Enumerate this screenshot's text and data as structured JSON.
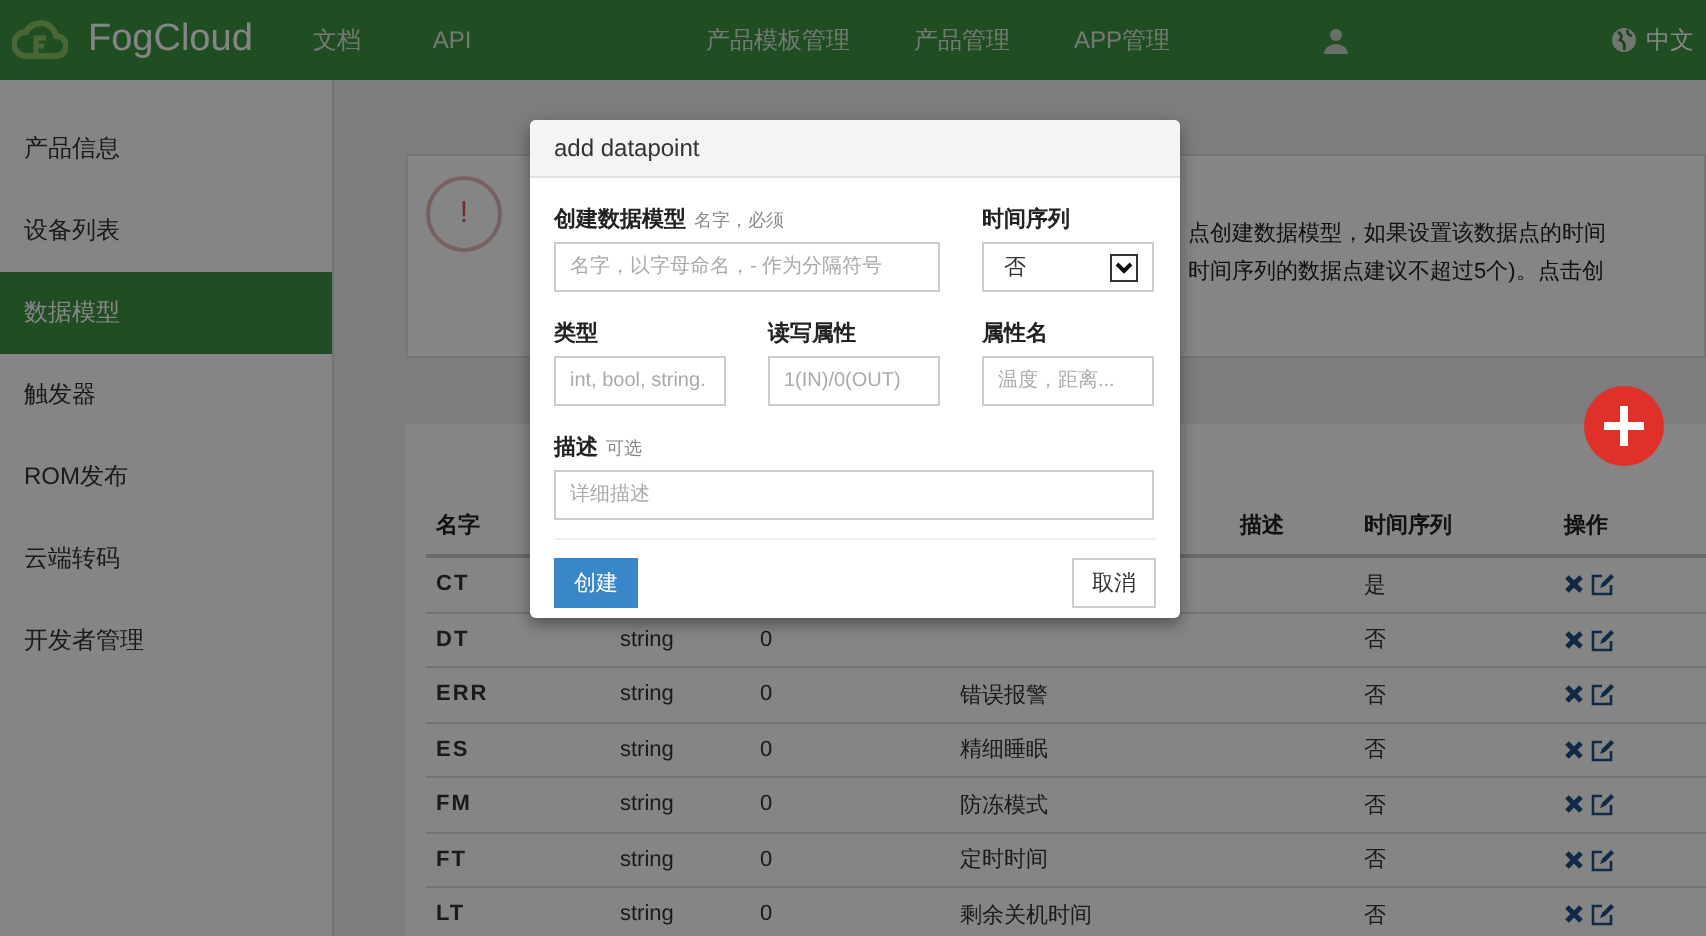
{
  "header": {
    "brand": "FogCloud",
    "nav_left": [
      "文档",
      "API"
    ],
    "nav_right": [
      "产品模板管理",
      "产品管理",
      "APP管理"
    ],
    "language": "中文"
  },
  "sidebar": {
    "items": [
      {
        "label": "产品信息",
        "selected": false
      },
      {
        "label": "设备列表",
        "selected": false
      },
      {
        "label": "数据模型",
        "selected": true
      },
      {
        "label": "触发器",
        "selected": false
      },
      {
        "label": "ROM发布",
        "selected": false
      },
      {
        "label": "云端转码",
        "selected": false
      },
      {
        "label": "开发者管理",
        "selected": false
      }
    ]
  },
  "notice": {
    "icon": "!",
    "lines": [
      "点创建数据模型，如果设置该数据点的时间",
      "时间序列的数据点建议不超过5个)。点击创"
    ]
  },
  "table": {
    "columns": [
      "名字",
      null,
      null,
      null,
      "描述",
      "时间序列",
      "操作"
    ],
    "rows": [
      [
        "CT",
        null,
        null,
        null,
        null,
        "是"
      ],
      [
        "DT",
        "string",
        "0",
        null,
        null,
        "否"
      ],
      [
        "ERR",
        "string",
        "0",
        "错误报警",
        null,
        "否"
      ],
      [
        "ES",
        "string",
        "0",
        "精细睡眠",
        null,
        "否"
      ],
      [
        "FM",
        "string",
        "0",
        "防冻模式",
        null,
        "否"
      ],
      [
        "FT",
        "string",
        "0",
        "定时时间",
        null,
        "否"
      ],
      [
        "LT",
        "string",
        "0",
        "剩余关机时间",
        null,
        "否"
      ]
    ]
  },
  "dialog": {
    "title": "add datapoint",
    "name_field": {
      "label": "创建数据模型",
      "hint": "名字，必须",
      "placeholder": "名字，以字母命名，- 作为分隔符号"
    },
    "series_field": {
      "label": "时间序列",
      "value": "否"
    },
    "type_field": {
      "label": "类型",
      "placeholder": "int, bool, string."
    },
    "rw_field": {
      "label": "读写属性",
      "placeholder": "1(IN)/0(OUT)"
    },
    "attr_field": {
      "label": "属性名",
      "placeholder": "温度，距离..."
    },
    "desc_field": {
      "label": "描述",
      "hint": "可选",
      "placeholder": "详细描述"
    },
    "buttons": [
      "创建",
      "取消"
    ]
  }
}
